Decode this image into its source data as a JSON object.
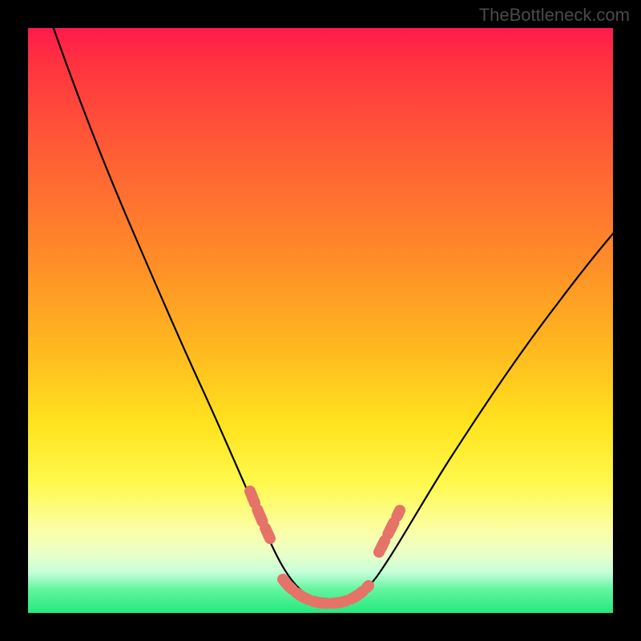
{
  "watermark": "TheBottleneck.com",
  "colors": {
    "frame": "#000000",
    "curve": "#000000",
    "beads": "#e57368",
    "gradient_top": "#ff1a4d",
    "gradient_mid": "#ffe41e",
    "gradient_bottom": "#24e97d"
  },
  "chart_data": {
    "type": "line",
    "title": "",
    "xlabel": "",
    "ylabel": "",
    "xlim": [
      0,
      100
    ],
    "ylim": [
      0,
      100
    ],
    "grid": false,
    "series": [
      {
        "name": "bottleneck-curve",
        "x": [
          0,
          4,
          8,
          12,
          16,
          20,
          24,
          28,
          32,
          35,
          38,
          41,
          44,
          46,
          48,
          50,
          52,
          54,
          56,
          58,
          61,
          65,
          70,
          76,
          82,
          88,
          94,
          100
        ],
        "values": [
          100,
          92,
          83,
          75,
          66,
          58,
          50,
          42,
          34,
          27,
          21,
          15,
          10,
          6,
          3,
          2,
          2,
          3,
          5,
          8,
          12,
          18,
          26,
          35,
          44,
          53,
          62,
          70
        ]
      }
    ],
    "markers": [
      {
        "name": "left-bead-1",
        "x": 37,
        "y": 19.5
      },
      {
        "name": "left-bead-2",
        "x": 39,
        "y": 15.0
      },
      {
        "name": "left-bead-3",
        "x": 41,
        "y": 11.0
      },
      {
        "name": "bottom-bead-1",
        "x": 44,
        "y": 4.5
      },
      {
        "name": "bottom-bead-2",
        "x": 47,
        "y": 2.5
      },
      {
        "name": "bottom-bead-3",
        "x": 50,
        "y": 2.0
      },
      {
        "name": "bottom-bead-4",
        "x": 53,
        "y": 2.5
      },
      {
        "name": "bottom-bead-5",
        "x": 56,
        "y": 4.5
      },
      {
        "name": "right-bead-1",
        "x": 59,
        "y": 10.0
      },
      {
        "name": "right-bead-2",
        "x": 61,
        "y": 14.0
      },
      {
        "name": "right-bead-3",
        "x": 63,
        "y": 18.0
      }
    ]
  }
}
